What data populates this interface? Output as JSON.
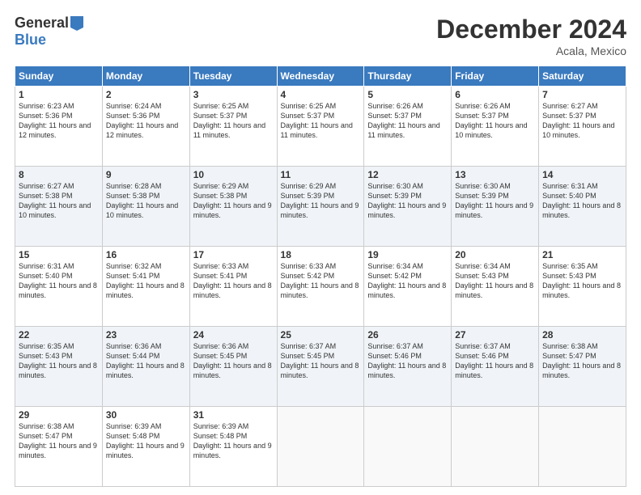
{
  "logo": {
    "general": "General",
    "blue": "Blue"
  },
  "header": {
    "title": "December 2024",
    "location": "Acala, Mexico"
  },
  "weekdays": [
    "Sunday",
    "Monday",
    "Tuesday",
    "Wednesday",
    "Thursday",
    "Friday",
    "Saturday"
  ],
  "weeks": [
    [
      {
        "day": "1",
        "sunrise": "6:23 AM",
        "sunset": "5:36 PM",
        "daylight": "11 hours and 12 minutes."
      },
      {
        "day": "2",
        "sunrise": "6:24 AM",
        "sunset": "5:36 PM",
        "daylight": "11 hours and 12 minutes."
      },
      {
        "day": "3",
        "sunrise": "6:25 AM",
        "sunset": "5:37 PM",
        "daylight": "11 hours and 11 minutes."
      },
      {
        "day": "4",
        "sunrise": "6:25 AM",
        "sunset": "5:37 PM",
        "daylight": "11 hours and 11 minutes."
      },
      {
        "day": "5",
        "sunrise": "6:26 AM",
        "sunset": "5:37 PM",
        "daylight": "11 hours and 11 minutes."
      },
      {
        "day": "6",
        "sunrise": "6:26 AM",
        "sunset": "5:37 PM",
        "daylight": "11 hours and 10 minutes."
      },
      {
        "day": "7",
        "sunrise": "6:27 AM",
        "sunset": "5:37 PM",
        "daylight": "11 hours and 10 minutes."
      }
    ],
    [
      {
        "day": "8",
        "sunrise": "6:27 AM",
        "sunset": "5:38 PM",
        "daylight": "11 hours and 10 minutes."
      },
      {
        "day": "9",
        "sunrise": "6:28 AM",
        "sunset": "5:38 PM",
        "daylight": "11 hours and 10 minutes."
      },
      {
        "day": "10",
        "sunrise": "6:29 AM",
        "sunset": "5:38 PM",
        "daylight": "11 hours and 9 minutes."
      },
      {
        "day": "11",
        "sunrise": "6:29 AM",
        "sunset": "5:39 PM",
        "daylight": "11 hours and 9 minutes."
      },
      {
        "day": "12",
        "sunrise": "6:30 AM",
        "sunset": "5:39 PM",
        "daylight": "11 hours and 9 minutes."
      },
      {
        "day": "13",
        "sunrise": "6:30 AM",
        "sunset": "5:39 PM",
        "daylight": "11 hours and 9 minutes."
      },
      {
        "day": "14",
        "sunrise": "6:31 AM",
        "sunset": "5:40 PM",
        "daylight": "11 hours and 8 minutes."
      }
    ],
    [
      {
        "day": "15",
        "sunrise": "6:31 AM",
        "sunset": "5:40 PM",
        "daylight": "11 hours and 8 minutes."
      },
      {
        "day": "16",
        "sunrise": "6:32 AM",
        "sunset": "5:41 PM",
        "daylight": "11 hours and 8 minutes."
      },
      {
        "day": "17",
        "sunrise": "6:33 AM",
        "sunset": "5:41 PM",
        "daylight": "11 hours and 8 minutes."
      },
      {
        "day": "18",
        "sunrise": "6:33 AM",
        "sunset": "5:42 PM",
        "daylight": "11 hours and 8 minutes."
      },
      {
        "day": "19",
        "sunrise": "6:34 AM",
        "sunset": "5:42 PM",
        "daylight": "11 hours and 8 minutes."
      },
      {
        "day": "20",
        "sunrise": "6:34 AM",
        "sunset": "5:43 PM",
        "daylight": "11 hours and 8 minutes."
      },
      {
        "day": "21",
        "sunrise": "6:35 AM",
        "sunset": "5:43 PM",
        "daylight": "11 hours and 8 minutes."
      }
    ],
    [
      {
        "day": "22",
        "sunrise": "6:35 AM",
        "sunset": "5:43 PM",
        "daylight": "11 hours and 8 minutes."
      },
      {
        "day": "23",
        "sunrise": "6:36 AM",
        "sunset": "5:44 PM",
        "daylight": "11 hours and 8 minutes."
      },
      {
        "day": "24",
        "sunrise": "6:36 AM",
        "sunset": "5:45 PM",
        "daylight": "11 hours and 8 minutes."
      },
      {
        "day": "25",
        "sunrise": "6:37 AM",
        "sunset": "5:45 PM",
        "daylight": "11 hours and 8 minutes."
      },
      {
        "day": "26",
        "sunrise": "6:37 AM",
        "sunset": "5:46 PM",
        "daylight": "11 hours and 8 minutes."
      },
      {
        "day": "27",
        "sunrise": "6:37 AM",
        "sunset": "5:46 PM",
        "daylight": "11 hours and 8 minutes."
      },
      {
        "day": "28",
        "sunrise": "6:38 AM",
        "sunset": "5:47 PM",
        "daylight": "11 hours and 8 minutes."
      }
    ],
    [
      {
        "day": "29",
        "sunrise": "6:38 AM",
        "sunset": "5:47 PM",
        "daylight": "11 hours and 9 minutes."
      },
      {
        "day": "30",
        "sunrise": "6:39 AM",
        "sunset": "5:48 PM",
        "daylight": "11 hours and 9 minutes."
      },
      {
        "day": "31",
        "sunrise": "6:39 AM",
        "sunset": "5:48 PM",
        "daylight": "11 hours and 9 minutes."
      },
      null,
      null,
      null,
      null
    ]
  ]
}
